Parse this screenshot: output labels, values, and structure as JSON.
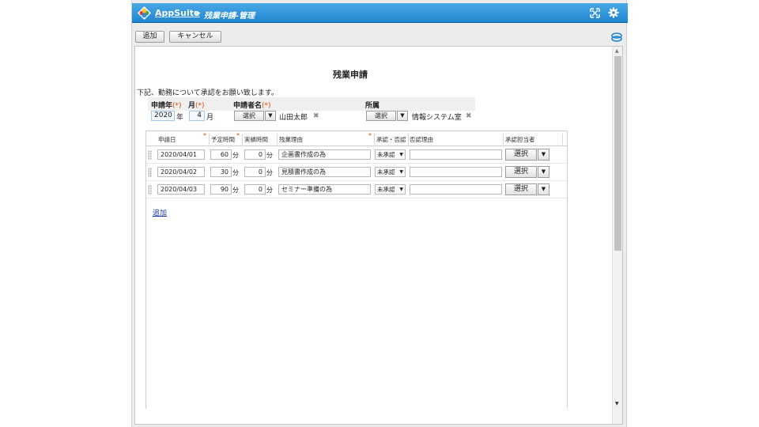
{
  "header": {
    "app_link": "AppSuite",
    "separator": ">",
    "page_title": "残業申請-管理"
  },
  "toolbar": {
    "add_label": "追加",
    "cancel_label": "キャンセル"
  },
  "form": {
    "title": "残業申請",
    "intro": "下記、勤務について承認をお願い致します。",
    "year_label": "申請年",
    "month_label": "月",
    "required_mark": "(*)",
    "applicant_label": "申請者名",
    "dept_label": "所属",
    "year_value": "2020",
    "year_unit": "年",
    "month_value": "4",
    "month_unit": "月",
    "select_label": "選択",
    "applicant_value": "山田太郎",
    "dept_value": "情報システム室"
  },
  "table": {
    "columns": [
      "申請日",
      "予定時間",
      "実績時間",
      "残業理由",
      "承認・否認",
      "否認理由",
      "承認担当者"
    ],
    "minute_unit": "分",
    "rows": [
      {
        "date": "2020/04/01",
        "planned": "60",
        "actual": "0",
        "reason": "企画書作成の為",
        "status": "未承認",
        "reject_reason": "",
        "approver_button": "選択"
      },
      {
        "date": "2020/04/02",
        "planned": "30",
        "actual": "0",
        "reason": "見積書作成の為",
        "status": "未承認",
        "reject_reason": "",
        "approver_button": "選択"
      },
      {
        "date": "2020/04/03",
        "planned": "90",
        "actual": "0",
        "reason": "セミナー準備の為",
        "status": "未承認",
        "reject_reason": "",
        "approver_button": "選択"
      }
    ],
    "add_row_link": "追加"
  },
  "colors": {
    "titlebar": "#1f86d0",
    "required": "#e24b00",
    "link": "#1a3fa8"
  }
}
